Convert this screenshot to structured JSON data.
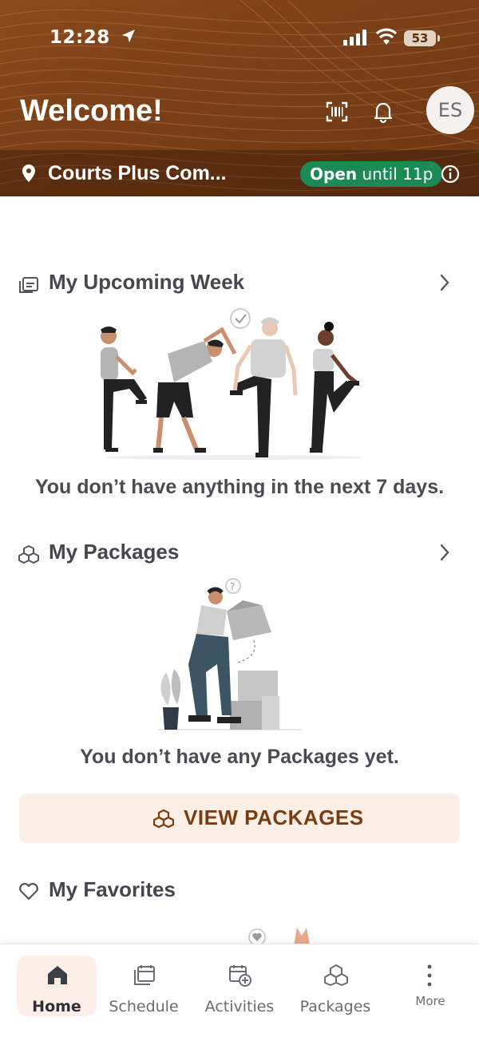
{
  "status_bar": {
    "time": "12:28",
    "battery": "53"
  },
  "header": {
    "title": "Welcome!",
    "avatar_initials": "ES"
  },
  "location": {
    "name": "Courts Plus Com...",
    "open_state": "Open",
    "open_until": "until 11p"
  },
  "upcoming": {
    "title": "My Upcoming Week",
    "empty_message": "You don’t have anything in the next 7 days."
  },
  "packages": {
    "title": "My Packages",
    "empty_message": "You don’t have any Packages yet.",
    "button_label": "VIEW PACKAGES"
  },
  "favorites": {
    "title": "My Favorites"
  },
  "tabs": [
    {
      "label": "Home",
      "icon": "home-icon",
      "active": true
    },
    {
      "label": "Schedule",
      "icon": "calendar-icon"
    },
    {
      "label": "Activities",
      "icon": "calendar-add-icon"
    },
    {
      "label": "Packages",
      "icon": "cubes-icon"
    },
    {
      "label": "More",
      "icon": "more-vertical-icon"
    }
  ],
  "colors": {
    "brand_brown": "#7a3f17",
    "open_green": "#1b8a55",
    "button_bg": "#fbefe8",
    "button_text": "#7a3d10"
  }
}
